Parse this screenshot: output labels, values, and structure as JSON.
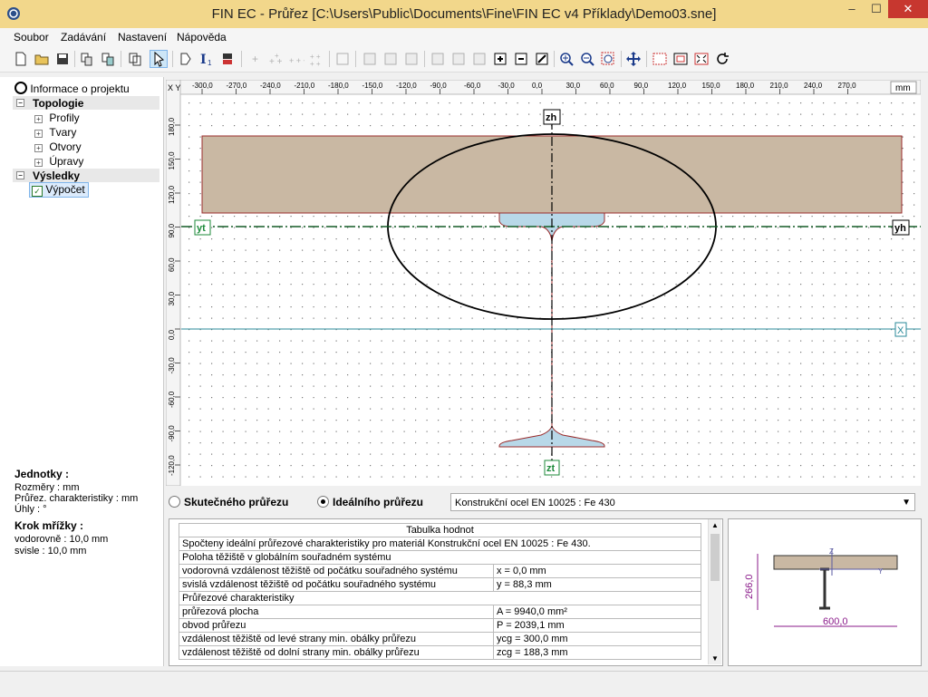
{
  "window": {
    "title": "FIN EC - Průřez [C:\\Users\\Public\\Documents\\Fine\\FIN EC v4 Příklady\\Demo03.sne]",
    "minimize": "–",
    "restore": "☐",
    "close": "✕",
    "accent": "#f2d78b",
    "close_color": "#c7372f"
  },
  "menu": [
    "Soubor",
    "Zadávání",
    "Nastavení",
    "Nápověda"
  ],
  "tree": {
    "project_info": "Informace o projektu",
    "topology": "Topologie",
    "topology_items": [
      "Profily",
      "Tvary",
      "Otvory",
      "Úpravy"
    ],
    "results": "Výsledky",
    "results_items": [
      "Výpočet"
    ]
  },
  "units": {
    "title": "Jednotky :",
    "dims": "Rozměry : mm",
    "props": "Průřez. charakteristiky : mm",
    "angles": "Úhly : °",
    "grid_title": "Krok mřížky :",
    "grid_h": "vodorovně : 10,0 mm",
    "grid_v": "svisle : 10,0 mm"
  },
  "canvas": {
    "x_ticks": [
      "-300,0",
      "-270,0",
      "-240,0",
      "-210,0",
      "-180,0",
      "-150,0",
      "-120,0",
      "-90,0",
      "-60,0",
      "-30,0",
      "0,0",
      "30,0",
      "60,0",
      "90,0",
      "120,0",
      "150,0",
      "180,0",
      "210,0",
      "240,0",
      "270,0"
    ],
    "y_ticks": [
      "180,0",
      "150,0",
      "120,0",
      "90,0",
      "60,0",
      "30,0",
      "0,0",
      "-30,0",
      "-60,0",
      "-90,0",
      "-120,0"
    ],
    "unit": "mm",
    "corner": "X Y",
    "axis_zh": "zh",
    "axis_yh": "yh",
    "axis_yt": "yt",
    "axis_zt": "zt",
    "axis_x": "X",
    "slab_color": "#c9b8a3",
    "steel_color": "#b8d8e8"
  },
  "options": {
    "real": "Skutečného průřezu",
    "ideal": "Ideálního průřezu",
    "material": "Konstrukční ocel EN 10025 : Fe 430"
  },
  "table": {
    "header": "Tabulka hodnot",
    "rows": [
      [
        "Spočteny ideální průřezové charakteristiky pro materiál Konstrukční ocel EN 10025 : Fe 430.",
        ""
      ],
      [
        "Poloha těžiště v globálním souřadném systému",
        ""
      ],
      [
        "vodorovná vzdálenost těžiště od počátku souřadného systému",
        "x = 0,0 mm"
      ],
      [
        "svislá vzdálenost těžiště od počátku souřadného systému",
        "y = 88,3 mm"
      ],
      [
        "Průřezové charakteristiky",
        ""
      ],
      [
        "průřezová plocha",
        "A = 9940,0 mm²"
      ],
      [
        "obvod průřezu",
        "P = 2039,1 mm"
      ],
      [
        "vzdálenost těžiště od levé strany min. obálky průřezu",
        "ycg = 300,0 mm"
      ],
      [
        "vzdálenost těžiště od dolní strany min. obálky průřezu",
        "zcg = 188,3 mm"
      ]
    ]
  },
  "preview": {
    "height": "266,0",
    "width": "600,0",
    "axis_z": "Z",
    "axis_y": "Y"
  },
  "icons": {
    "toolbar": [
      "new-file-icon",
      "open-folder-icon",
      "save-icon",
      "copy-icon",
      "paste-icon",
      "copy-view-icon",
      "pointer-icon",
      "text-icon",
      "dimension-icon",
      "eraser-icon",
      "add-point-icon",
      "add-points-icon",
      "add-points-row-icon",
      "add-points-grid-icon",
      "snap-icon",
      "add-section-icon",
      "remove-section-icon",
      "star-icon",
      "plus-icon",
      "minus-icon",
      "mark-icon",
      "merge-icon",
      "split-icon",
      "fill-icon",
      "zoom-in-icon",
      "zoom-out-icon",
      "zoom-window-icon",
      "pan-icon",
      "select-box-icon",
      "frame-icon",
      "fit-icon",
      "refresh-icon"
    ]
  }
}
